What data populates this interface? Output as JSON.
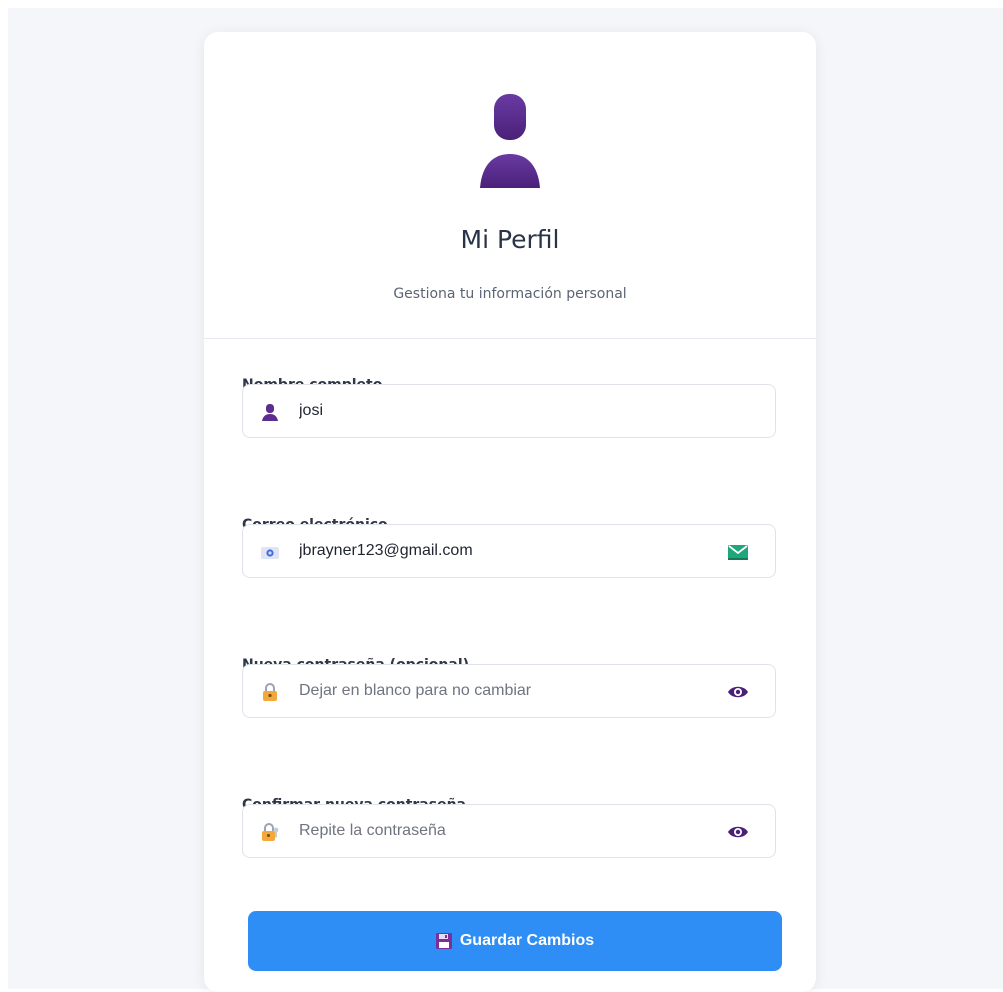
{
  "header": {
    "title": "Mi Perfil",
    "subtitle": "Gestiona tu información personal",
    "avatar_icon": "user-silhouette-icon"
  },
  "form": {
    "name": {
      "label": "Nombre completo",
      "value": "josi",
      "icon": "user-icon"
    },
    "email": {
      "label": "Correo electrónico",
      "value": "jbrayner123@gmail.com",
      "icon": "id-card-icon",
      "trailing_icon": "envelope-icon"
    },
    "new_password": {
      "label": "Nueva contraseña (opcional)",
      "placeholder": "Dejar en blanco para no cambiar",
      "icon": "lock-icon",
      "trailing_icon": "eye-icon"
    },
    "confirm_password": {
      "label": "Confirmar nueva contraseña",
      "placeholder": "Repite la contraseña",
      "icon": "lock-key-icon",
      "trailing_icon": "eye-icon"
    }
  },
  "actions": {
    "save_label": "Guardar Cambios",
    "save_icon": "floppy-disk-icon"
  },
  "colors": {
    "accent": "#2f8df6",
    "avatar": "#5b2d8e",
    "background": "#f4f6f9"
  }
}
